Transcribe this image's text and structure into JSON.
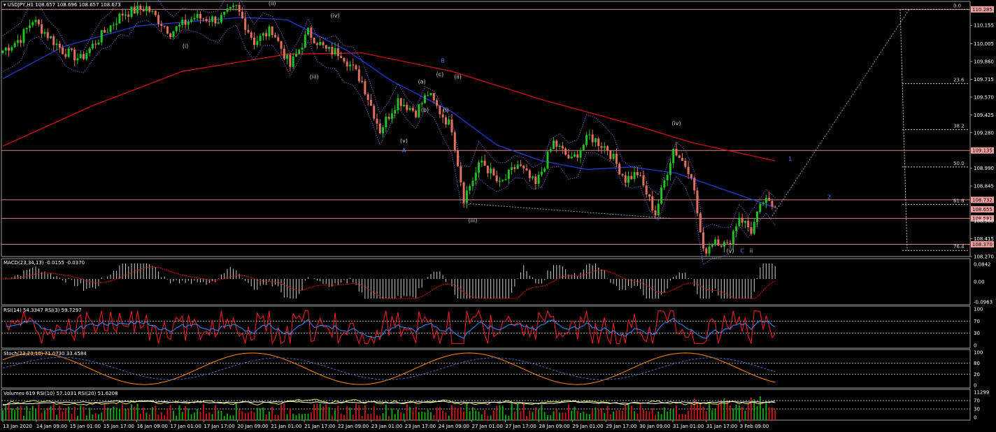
{
  "chart_data": {
    "type": "candlestick",
    "symbol": "USDJPY,H1",
    "ohlc": [
      108.657,
      108.696,
      108.657,
      108.673
    ],
    "ohlc_text": "108.657 108.696 108.657 108.673",
    "price_axis": [
      "110.155",
      "110.005",
      "109.860",
      "109.715",
      "109.570",
      "109.425",
      "109.280",
      "108.990",
      "108.845",
      "108.560",
      "108.415",
      "108.270"
    ],
    "ylim": [
      108.27,
      110.35
    ],
    "price_tags": [
      "110.285",
      "109.135",
      "108.732",
      "108.655",
      "108.581",
      "108.370"
    ],
    "hlines": [
      110.285,
      109.135,
      108.732,
      108.581,
      108.37
    ],
    "fib_levels": [
      {
        "label": "0.0",
        "price": 110.285
      },
      {
        "label": "23.6",
        "price": 109.68
      },
      {
        "label": "38.2",
        "price": 109.305
      },
      {
        "label": "50.0",
        "price": 109.0
      },
      {
        "label": "61.8",
        "price": 108.695
      },
      {
        "label": "76.4",
        "price": 108.32
      }
    ],
    "x_labels": [
      "13 Jan 2020",
      "14 Jan 09:00",
      "15 Jan 01:00",
      "15 Jan 17:00",
      "16 Jan 09:00",
      "17 Jan 01:00",
      "17 Jan 17:00",
      "20 Jan 09:00",
      "21 Jan 01:00",
      "21 Jan 17:00",
      "22 Jan 09:00",
      "23 Jan 01:00",
      "23 Jan 17:00",
      "24 Jan 09:00",
      "27 Jan 01:00",
      "27 Jan 17:00",
      "28 Jan 09:00",
      "29 Jan 01:00",
      "29 Jan 17:00",
      "30 Jan 09:00",
      "31 Jan 01:00",
      "31 Jan 17:00",
      "3 Feb 09:00"
    ],
    "anchors": [
      {
        "t": 0,
        "p": 109.95
      },
      {
        "t": 6,
        "p": 110.05
      },
      {
        "t": 10,
        "p": 110.2
      },
      {
        "t": 20,
        "p": 109.95
      },
      {
        "t": 26,
        "p": 109.88
      },
      {
        "t": 34,
        "p": 110.1
      },
      {
        "t": 40,
        "p": 110.25
      },
      {
        "t": 48,
        "p": 110.3
      },
      {
        "t": 56,
        "p": 110.1
      },
      {
        "t": 64,
        "p": 110.22
      },
      {
        "t": 72,
        "p": 110.2
      },
      {
        "t": 78,
        "p": 110.3
      },
      {
        "t": 84,
        "p": 110.02
      },
      {
        "t": 90,
        "p": 110.12
      },
      {
        "t": 96,
        "p": 109.82
      },
      {
        "t": 102,
        "p": 110.1
      },
      {
        "t": 108,
        "p": 109.95
      },
      {
        "t": 113,
        "p": 109.93
      },
      {
        "t": 120,
        "p": 109.7
      },
      {
        "t": 126,
        "p": 109.3
      },
      {
        "t": 132,
        "p": 109.55
      },
      {
        "t": 138,
        "p": 109.45
      },
      {
        "t": 142,
        "p": 109.6
      },
      {
        "t": 146,
        "p": 109.45
      },
      {
        "t": 150,
        "p": 109.32
      },
      {
        "t": 154,
        "p": 108.75
      },
      {
        "t": 160,
        "p": 109.05
      },
      {
        "t": 166,
        "p": 108.85
      },
      {
        "t": 172,
        "p": 109.02
      },
      {
        "t": 178,
        "p": 108.85
      },
      {
        "t": 184,
        "p": 109.2
      },
      {
        "t": 190,
        "p": 109.05
      },
      {
        "t": 196,
        "p": 109.25
      },
      {
        "t": 202,
        "p": 109.15
      },
      {
        "t": 208,
        "p": 108.9
      },
      {
        "t": 212,
        "p": 108.95
      },
      {
        "t": 218,
        "p": 108.62
      },
      {
        "t": 224,
        "p": 109.15
      },
      {
        "t": 230,
        "p": 108.95
      },
      {
        "t": 234,
        "p": 108.3
      },
      {
        "t": 238,
        "p": 108.42
      },
      {
        "t": 242,
        "p": 108.35
      },
      {
        "t": 246,
        "p": 108.6
      },
      {
        "t": 250,
        "p": 108.48
      },
      {
        "t": 254,
        "p": 108.72
      },
      {
        "t": 258,
        "p": 108.673
      }
    ],
    "bars_total": 258,
    "ma_slow_red": [
      [
        0,
        109.17
      ],
      [
        30,
        109.5
      ],
      [
        60,
        109.78
      ],
      [
        95,
        109.92
      ],
      [
        120,
        109.93
      ],
      [
        150,
        109.78
      ],
      [
        180,
        109.55
      ],
      [
        210,
        109.35
      ],
      [
        230,
        109.2
      ],
      [
        258,
        109.05
      ]
    ],
    "ma_blue": [
      [
        0,
        109.72
      ],
      [
        20,
        109.98
      ],
      [
        45,
        110.15
      ],
      [
        80,
        110.22
      ],
      [
        95,
        110.2
      ],
      [
        115,
        109.95
      ],
      [
        130,
        109.7
      ],
      [
        150,
        109.45
      ],
      [
        165,
        109.18
      ],
      [
        180,
        109.05
      ],
      [
        195,
        108.98
      ],
      [
        210,
        109.0
      ],
      [
        225,
        108.95
      ],
      [
        245,
        108.78
      ],
      [
        258,
        108.67
      ]
    ],
    "wave_labels": [
      {
        "text": "(i)",
        "t": 61,
        "p": 109.97,
        "blue": false
      },
      {
        "text": "(ii)",
        "t": 90,
        "p": 110.32,
        "blue": false
      },
      {
        "text": "(iii)",
        "t": 104,
        "p": 109.72,
        "blue": false
      },
      {
        "text": "(iv)",
        "t": 111,
        "p": 110.22,
        "blue": false
      },
      {
        "text": "(v)",
        "t": 134,
        "p": 109.2,
        "blue": false
      },
      {
        "text": "A",
        "t": 134,
        "p": 109.12,
        "blue": true
      },
      {
        "text": "B",
        "t": 147,
        "p": 109.85,
        "blue": true
      },
      {
        "text": "(a)",
        "t": 140,
        "p": 109.68,
        "blue": false
      },
      {
        "text": "(b)",
        "t": 141,
        "p": 109.45,
        "blue": false
      },
      {
        "text": "(c)",
        "t": 146,
        "p": 109.74,
        "blue": false
      },
      {
        "text": "(i)",
        "t": 148,
        "p": 109.45,
        "blue": false
      },
      {
        "text": "(ii)",
        "t": 152,
        "p": 109.72,
        "blue": false
      },
      {
        "text": "(iii)",
        "t": 157,
        "p": 108.55,
        "blue": false
      },
      {
        "text": "(iv)",
        "t": 225,
        "p": 109.34,
        "blue": false
      },
      {
        "text": "(v)",
        "t": 243,
        "p": 108.3,
        "blue": false
      },
      {
        "text": "C",
        "t": 247,
        "p": 108.3,
        "blue": true
      },
      {
        "text": "ii",
        "t": 250,
        "p": 108.3,
        "blue": false
      },
      {
        "text": "1",
        "t": 263,
        "p": 109.05,
        "blue": true
      },
      {
        "text": "2",
        "t": 276,
        "p": 108.74,
        "blue": true
      }
    ],
    "macd": {
      "title": "MACD(23,34,13) -0.0155 -0.0370",
      "axis": [
        "0.0842",
        "0.00",
        "-0.0963"
      ]
    },
    "rsi": {
      "title": "RSI(14) 54.3347  RSI(3) 59.7297",
      "axis": [
        "100",
        "70",
        "30",
        "0"
      ]
    },
    "stoch": {
      "title": "Stoch(23,23,10) 71.0730 33.4584",
      "axis": [
        "100",
        "80",
        "20",
        "0"
      ]
    },
    "volumes": {
      "title": "Volumes 619  RSI(10) 57.1031  RSI(20) 51.6208",
      "axis": [
        "11299",
        "70",
        "30",
        "0"
      ]
    },
    "colors": {
      "bull": "#22c022",
      "bear": "#e07060",
      "ma_red": "#e01010",
      "ma_blue": "#2040e0",
      "line": "#e08080",
      "price_tag": "#f4a0a0",
      "rsi_red": "#ff2020",
      "rsi_blue": "#3090ff",
      "stoch_orange": "#ff8c00",
      "stoch_blue": "#3a6fc0"
    }
  }
}
